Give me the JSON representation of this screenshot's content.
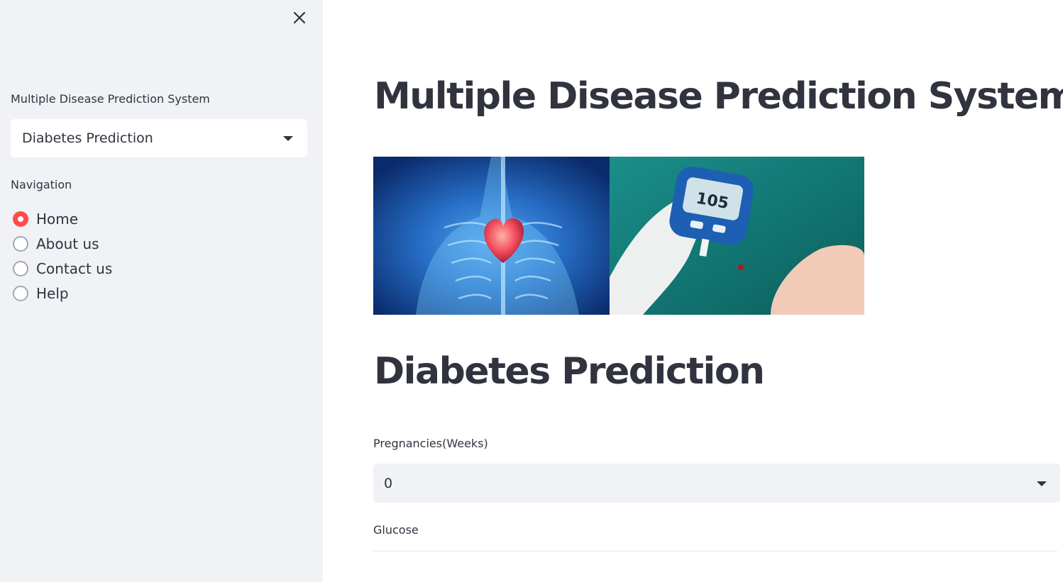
{
  "sidebar": {
    "select_label": "Multiple Disease Prediction System",
    "selected_value": "Diabetes Prediction",
    "nav_label": "Navigation",
    "nav_items": [
      {
        "label": "Home",
        "checked": true
      },
      {
        "label": "About us",
        "checked": false
      },
      {
        "label": "Contact us",
        "checked": false
      },
      {
        "label": "Help",
        "checked": false
      }
    ]
  },
  "main": {
    "title": "Multiple Disease Prediction System",
    "subtitle": "Diabetes Prediction",
    "hero_meter_reading": "105",
    "fields": [
      {
        "label": "Pregnancies(Weeks)",
        "value": "0"
      },
      {
        "label": "Glucose",
        "value": ""
      }
    ]
  },
  "colors": {
    "accent": "#ff4b4b",
    "sidebar_bg": "#f0f2f6",
    "text": "#31333f"
  }
}
